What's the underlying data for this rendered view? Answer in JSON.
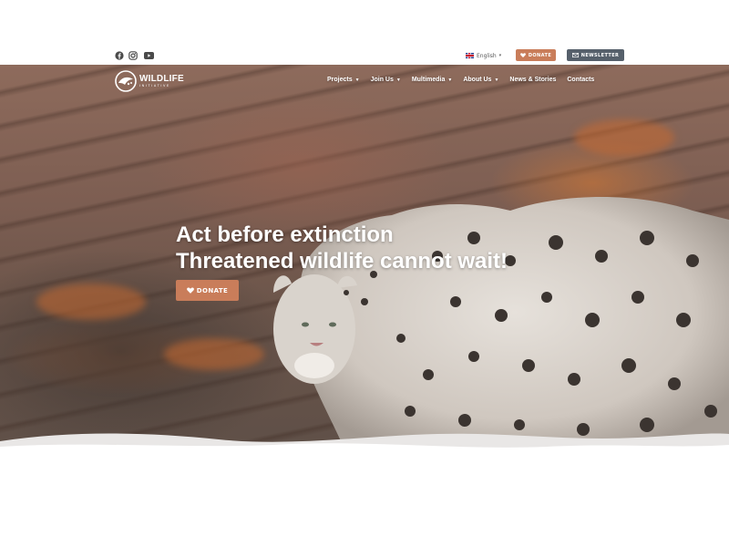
{
  "topbar": {
    "social": [
      "facebook-icon",
      "instagram-icon",
      "youtube-icon"
    ],
    "language": {
      "label": "English",
      "flag": "uk-flag-icon"
    },
    "donate_label": "DONATE",
    "newsletter_label": "NEWSLETTER"
  },
  "logo": {
    "main": "WILDLIFE",
    "sub": "INITIATIVE"
  },
  "nav": [
    {
      "label": "Projects",
      "dropdown": true
    },
    {
      "label": "Join Us",
      "dropdown": true
    },
    {
      "label": "Multimedia",
      "dropdown": true
    },
    {
      "label": "About Us",
      "dropdown": true
    },
    {
      "label": "News & Stories",
      "dropdown": false
    },
    {
      "label": "Contacts",
      "dropdown": false
    }
  ],
  "hero": {
    "line1": "Act before extinction",
    "line2": "Threatened wildlife cannot wait!",
    "donate_label": "DONATE"
  },
  "colors": {
    "accent": "#c97d5a",
    "secondary": "#56606b"
  }
}
